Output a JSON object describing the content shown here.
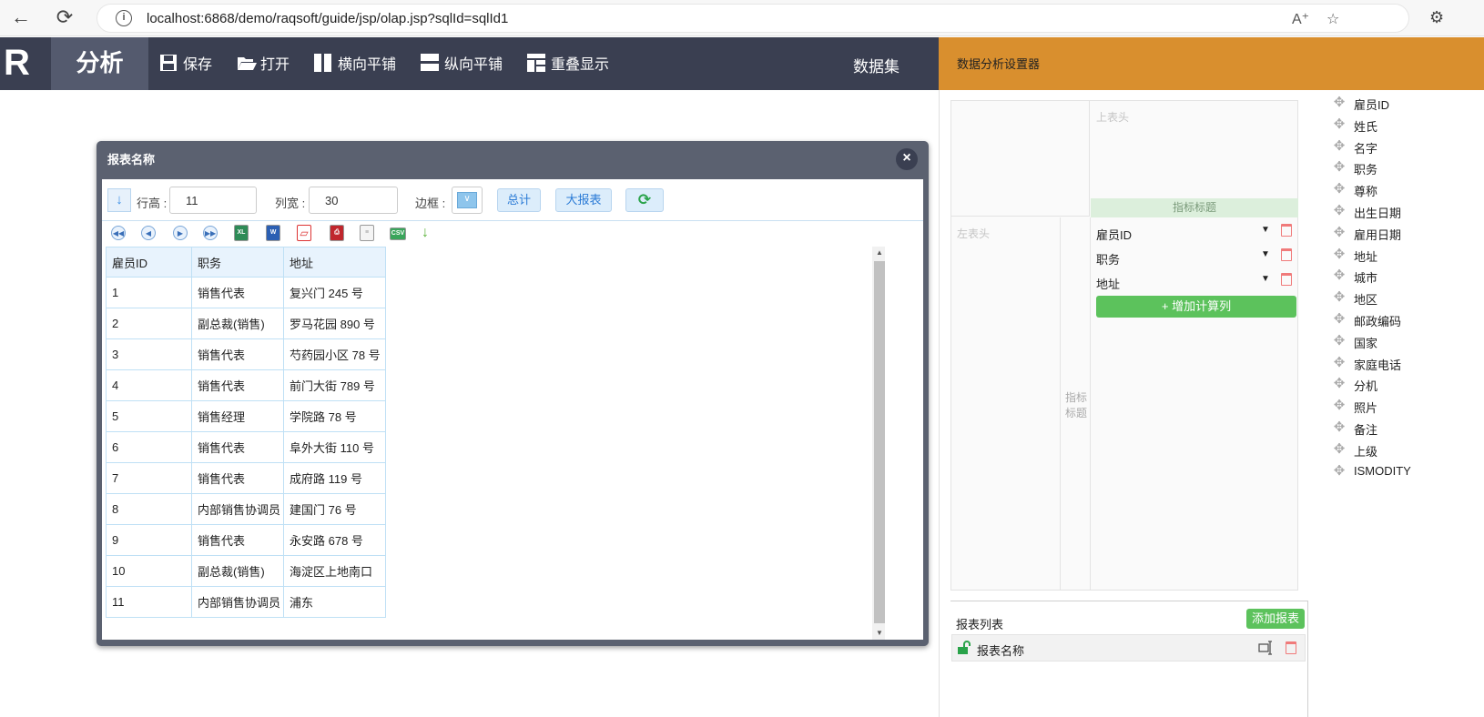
{
  "browser": {
    "url": "localhost:6868/demo/raqsoft/guide/jsp/olap.jsp?sqlId=sqlId1"
  },
  "toolbar": {
    "logo": "R",
    "analysis_label": "分析",
    "save_label": "保存",
    "open_label": "打开",
    "tile_h_label": "横向平铺",
    "tile_v_label": "纵向平铺",
    "overlap_label": "重叠显示",
    "dataset_label": "数据集"
  },
  "setting_panel": {
    "title": "数据分析设置器",
    "top_head_placeholder": "上表头",
    "left_head_placeholder": "左表头",
    "index_title_label": "指标标题",
    "index_col_label_1": "指标",
    "index_col_label_2": "标题",
    "measures": [
      {
        "label": "雇员ID"
      },
      {
        "label": "职务"
      },
      {
        "label": "地址"
      }
    ],
    "add_calc_label": "+ 增加计算列",
    "report_list_title": "报表列表",
    "add_report_label": "添加报表",
    "report_item_label": "报表名称"
  },
  "report_window": {
    "title": "报表名称",
    "row_height_label": "行高 :",
    "row_height_value": "11",
    "col_width_label": "列宽 :",
    "col_width_value": "30",
    "border_label": "边框 :",
    "total_label": "总计",
    "big_report_label": "大报表",
    "table": {
      "headers": [
        "雇员ID",
        "职务",
        "地址"
      ],
      "rows": [
        [
          "1",
          "销售代表",
          "复兴门 245 号"
        ],
        [
          "2",
          "副总裁(销售)",
          "罗马花园 890 号"
        ],
        [
          "3",
          "销售代表",
          "芍药园小区 78 号"
        ],
        [
          "4",
          "销售代表",
          "前门大街 789 号"
        ],
        [
          "5",
          "销售经理",
          "学院路 78 号"
        ],
        [
          "6",
          "销售代表",
          "阜外大街 110 号"
        ],
        [
          "7",
          "销售代表",
          "成府路 119 号"
        ],
        [
          "8",
          "内部销售协调员",
          "建国门 76 号"
        ],
        [
          "9",
          "销售代表",
          "永安路 678 号"
        ],
        [
          "10",
          "副总裁(销售)",
          "海淀区上地南口"
        ],
        [
          "11",
          "内部销售协调员",
          "浦东"
        ]
      ]
    }
  },
  "fields": [
    "雇员ID",
    "姓氏",
    "名字",
    "职务",
    "尊称",
    "出生日期",
    "雇用日期",
    "地址",
    "城市",
    "地区",
    "邮政编码",
    "国家",
    "家庭电话",
    "分机",
    "照片",
    "备注",
    "上级",
    "ISMODITY"
  ],
  "colors": {
    "app_bar": "#3a3f51",
    "orange": "#d98f2e",
    "green": "#5cc25c",
    "table_border": "#bfe0f5"
  }
}
